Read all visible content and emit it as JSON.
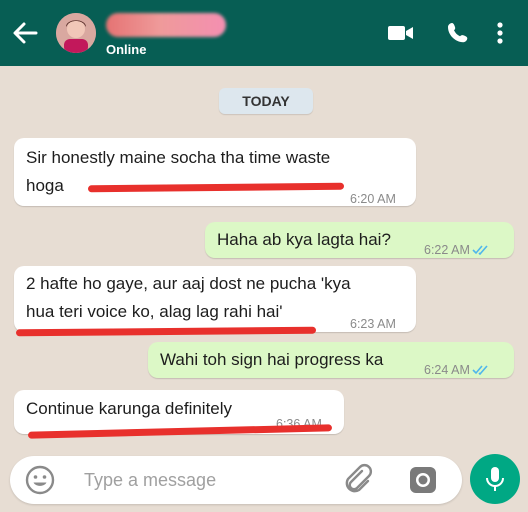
{
  "header": {
    "status": "Online",
    "icons": [
      "back-arrow-icon",
      "video-call-icon",
      "phone-icon",
      "more-options-icon"
    ],
    "color": "#075e54"
  },
  "chat": {
    "date_label": "TODAY",
    "messages": [
      {
        "direction": "incoming",
        "text": "Sir honestly maine socha tha time waste\nhoga",
        "time": "6:20 AM"
      },
      {
        "direction": "outgoing",
        "text": "Haha ab kya lagta hai?",
        "time": "6:22 AM",
        "status": "read"
      },
      {
        "direction": "incoming",
        "text": "2 hafte ho gaye, aur aaj dost ne pucha 'kya\nhua teri voice ko, alag lag rahi hai'",
        "time": "6:23 AM"
      },
      {
        "direction": "outgoing",
        "text": "Wahi toh sign hai progress ka",
        "time": "6:24 AM",
        "status": "read"
      },
      {
        "direction": "incoming",
        "text": "Continue karunga definitely",
        "time": "6:36 AM"
      }
    ]
  },
  "composer": {
    "placeholder": "Type a message",
    "icons": [
      "emoji-icon",
      "attach-icon",
      "camera-icon",
      "mic-icon"
    ],
    "accent": "#00a884"
  },
  "colors": {
    "incoming_bubble": "#ffffff",
    "outgoing_bubble": "#dcf8c6",
    "annotation": "#e8302c",
    "read_ticks": "#4fb6ec"
  }
}
